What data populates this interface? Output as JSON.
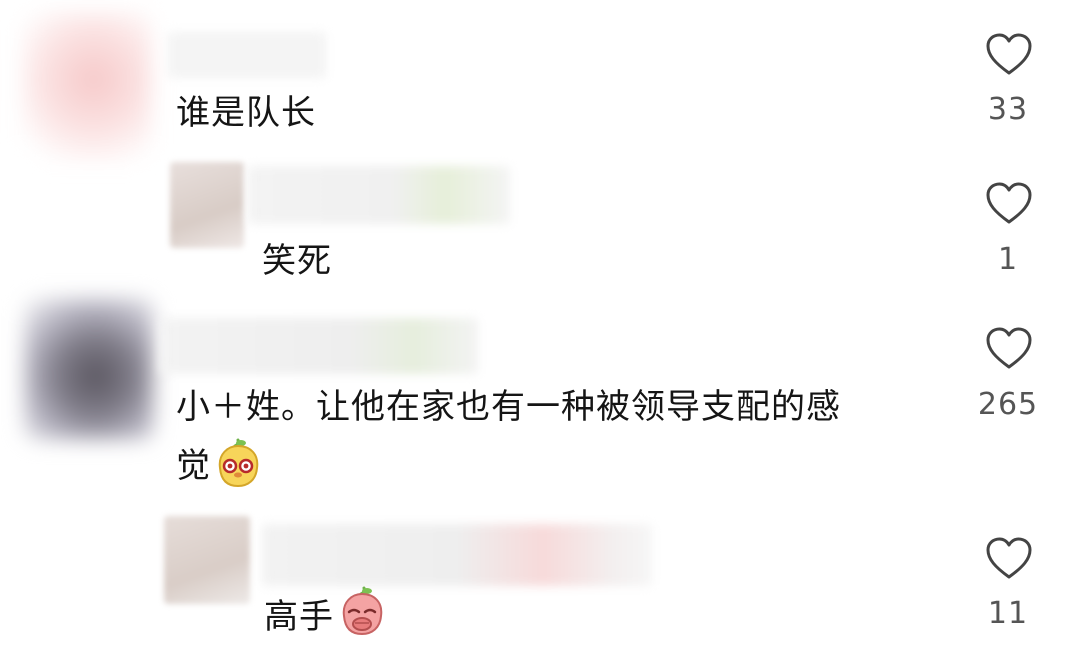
{
  "comments": [
    {
      "text": "谁是队长",
      "likes": "33",
      "emoji_after": null
    },
    {
      "text": "笑死",
      "likes": "1",
      "reply": true
    },
    {
      "text": "小＋姓。让他在家也有一种被领导支配的感",
      "text_line2": "觉",
      "likes": "265",
      "emoji_after": "yellow-smile-emoji"
    },
    {
      "text": "高手",
      "likes": "11",
      "reply": true,
      "emoji_after": "pink-cover-mouth-emoji"
    }
  ],
  "colors": {
    "heart_stroke": "#444444",
    "count_text": "#555555"
  },
  "icons": {
    "like": "heart-outline-icon"
  }
}
